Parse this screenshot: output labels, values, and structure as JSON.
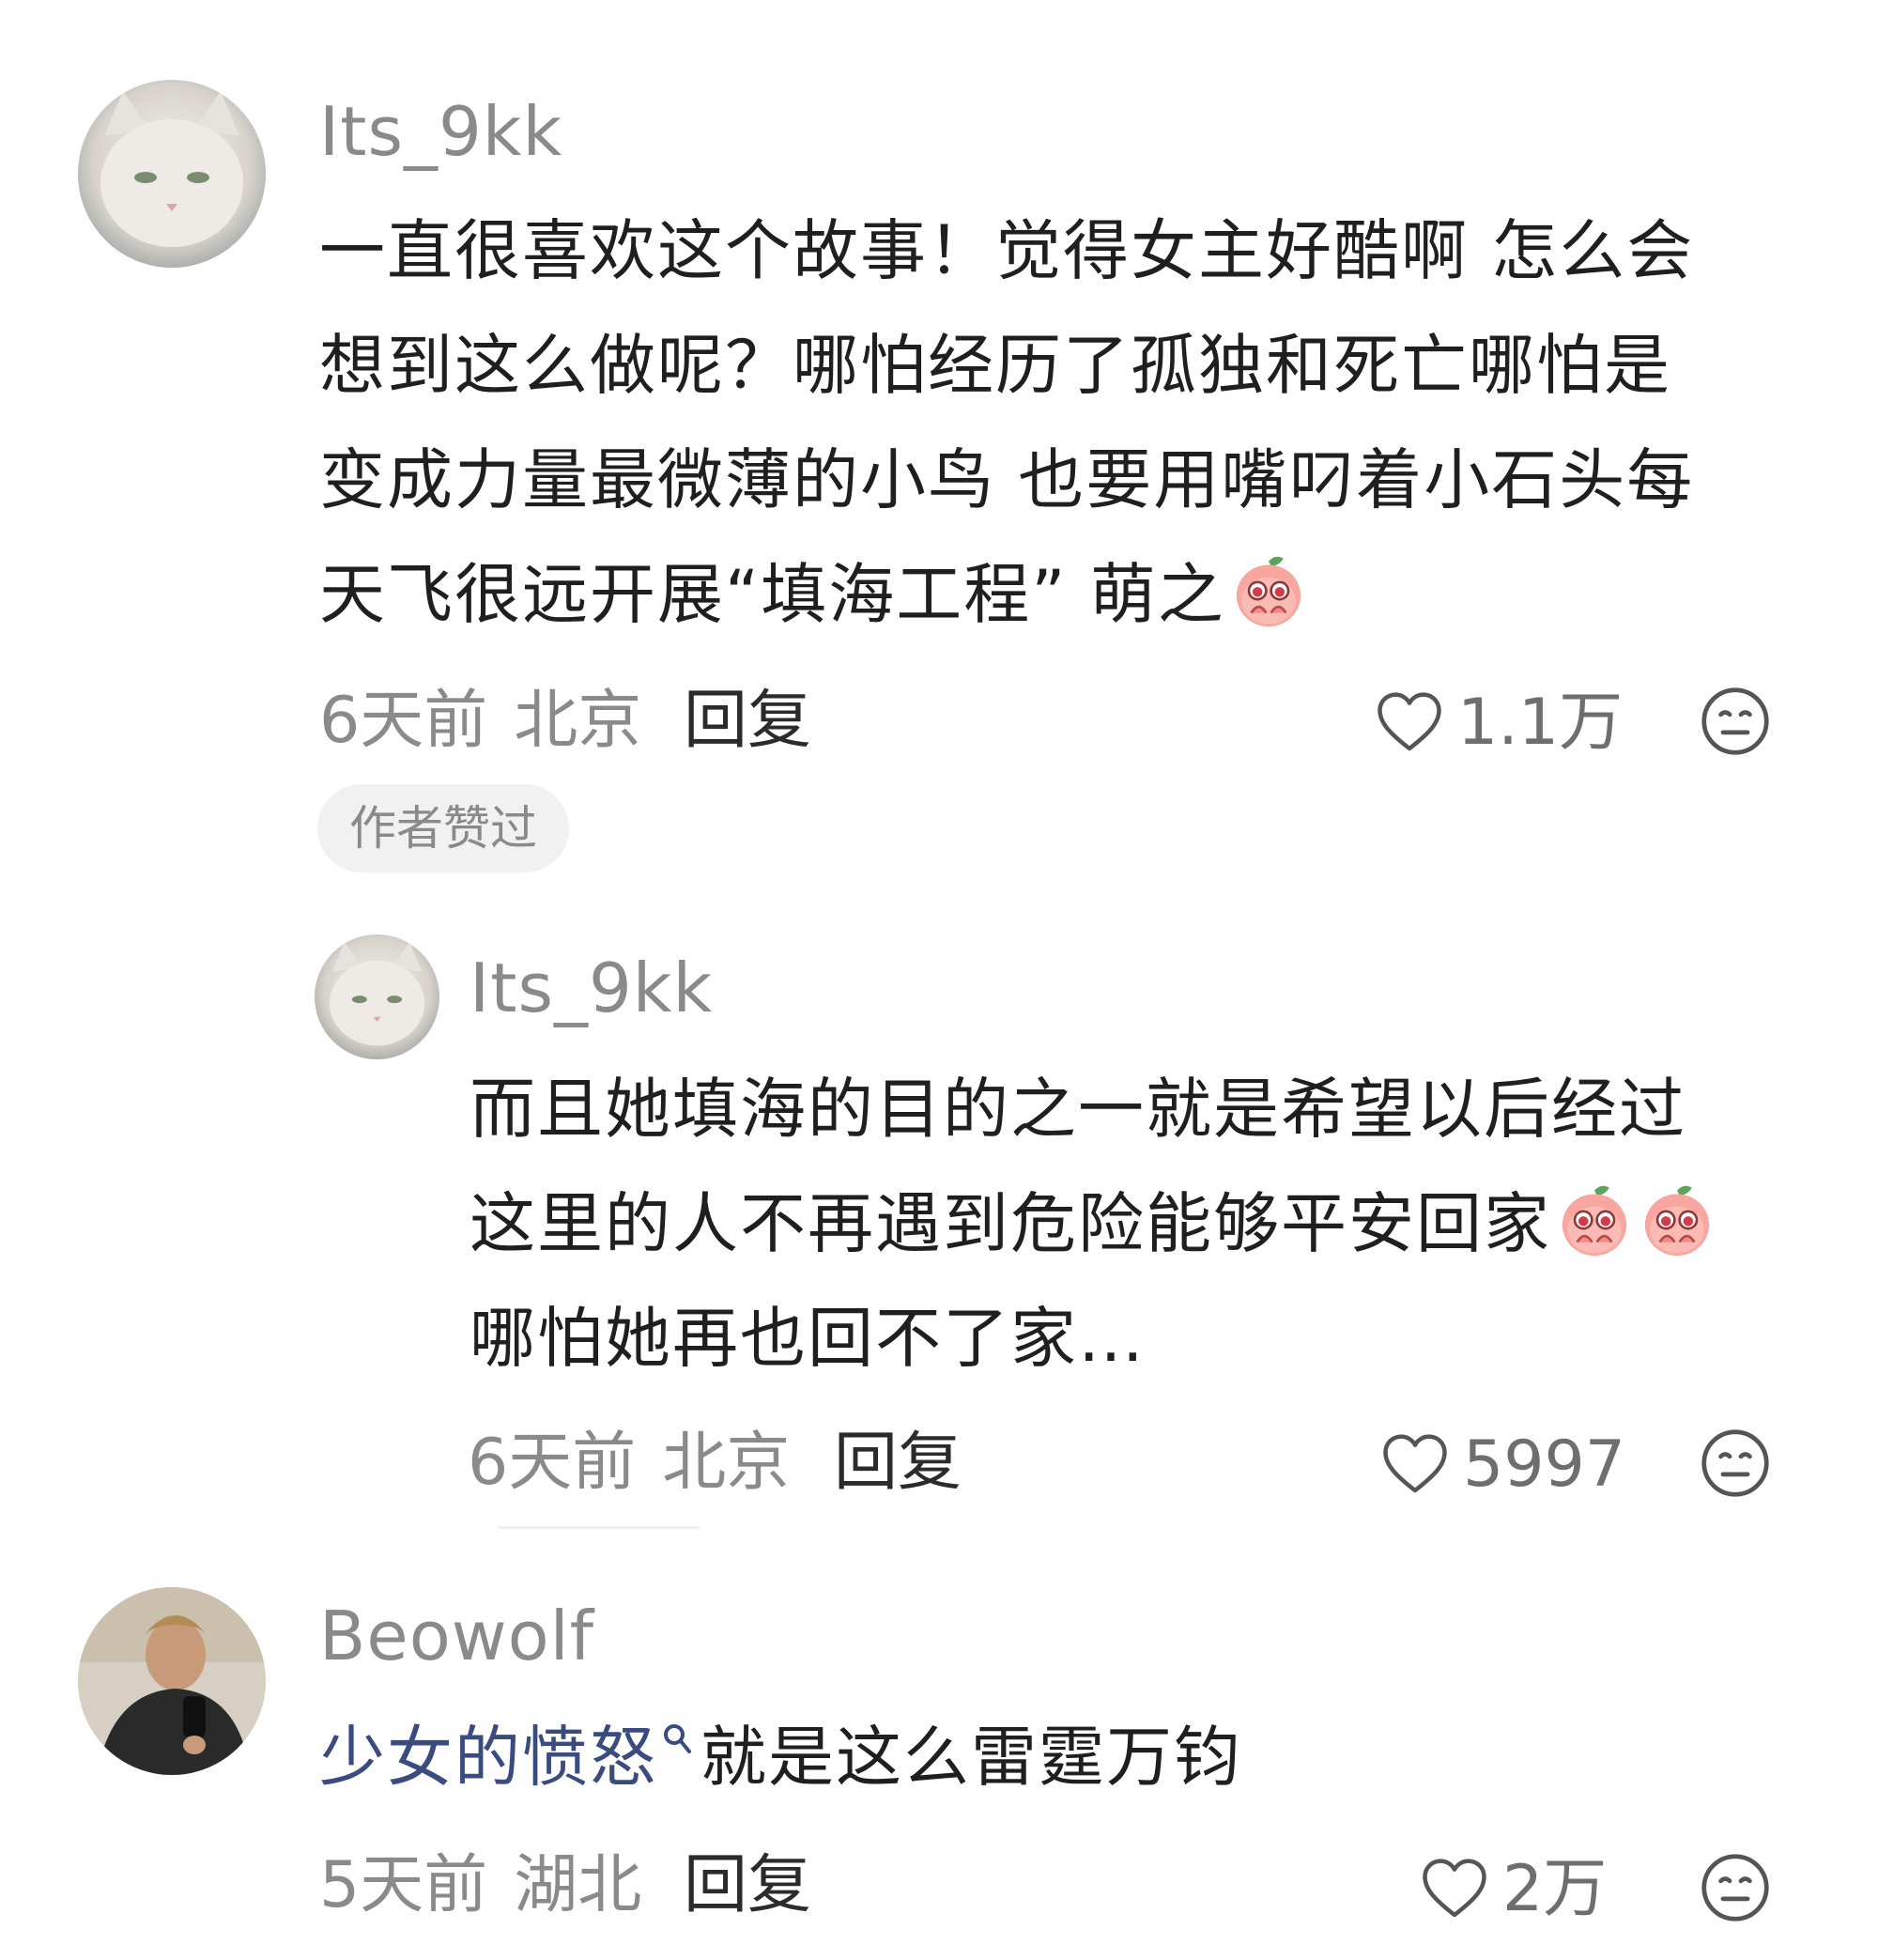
{
  "comments": [
    {
      "username": "Its_9kk",
      "lines": [
        "一直很喜欢这个故事！觉得女主好酷啊 怎么会",
        "想到这么做呢？哪怕经历了孤独和死亡哪怕是",
        "变成力量最微薄的小鸟 也要用嘴叼着小石头每",
        "天飞很远开展“填海工程” 萌之"
      ],
      "time": "6天前",
      "location": "北京",
      "reply_label": "回复",
      "likes": "1.1万",
      "badge": "作者赞过",
      "avatar_icon": "white-cat-avatar",
      "emoji_icon": "peach-crying-emoji"
    },
    {
      "username": "Its_9kk",
      "lines": [
        "而且她填海的目的之一就是希望以后经过",
        "这里的人不再遇到危险能够平安回家",
        "哪怕她再也回不了家…"
      ],
      "time": "6天前",
      "location": "北京",
      "reply_label": "回复",
      "likes": "5997",
      "avatar_icon": "white-cat-avatar",
      "emoji_icon": "peach-crying-emoji"
    },
    {
      "username": "Beowolf",
      "link_text": "少女的愤怒",
      "rest_text": "就是这么雷霆万钧",
      "time": "5天前",
      "location": "湖北",
      "reply_label": "回复",
      "likes": "2万",
      "avatar_icon": "man-selfie-avatar"
    }
  ],
  "icons": {
    "like": "heart-outline-icon",
    "dislike": "meh-face-icon",
    "search": "search-icon"
  },
  "colors": {
    "username": "#8a8a8a",
    "meta": "#8a8a8a",
    "text": "#1f1f1f",
    "link": "#3a4b80",
    "badge_bg": "#f1f1f1"
  }
}
